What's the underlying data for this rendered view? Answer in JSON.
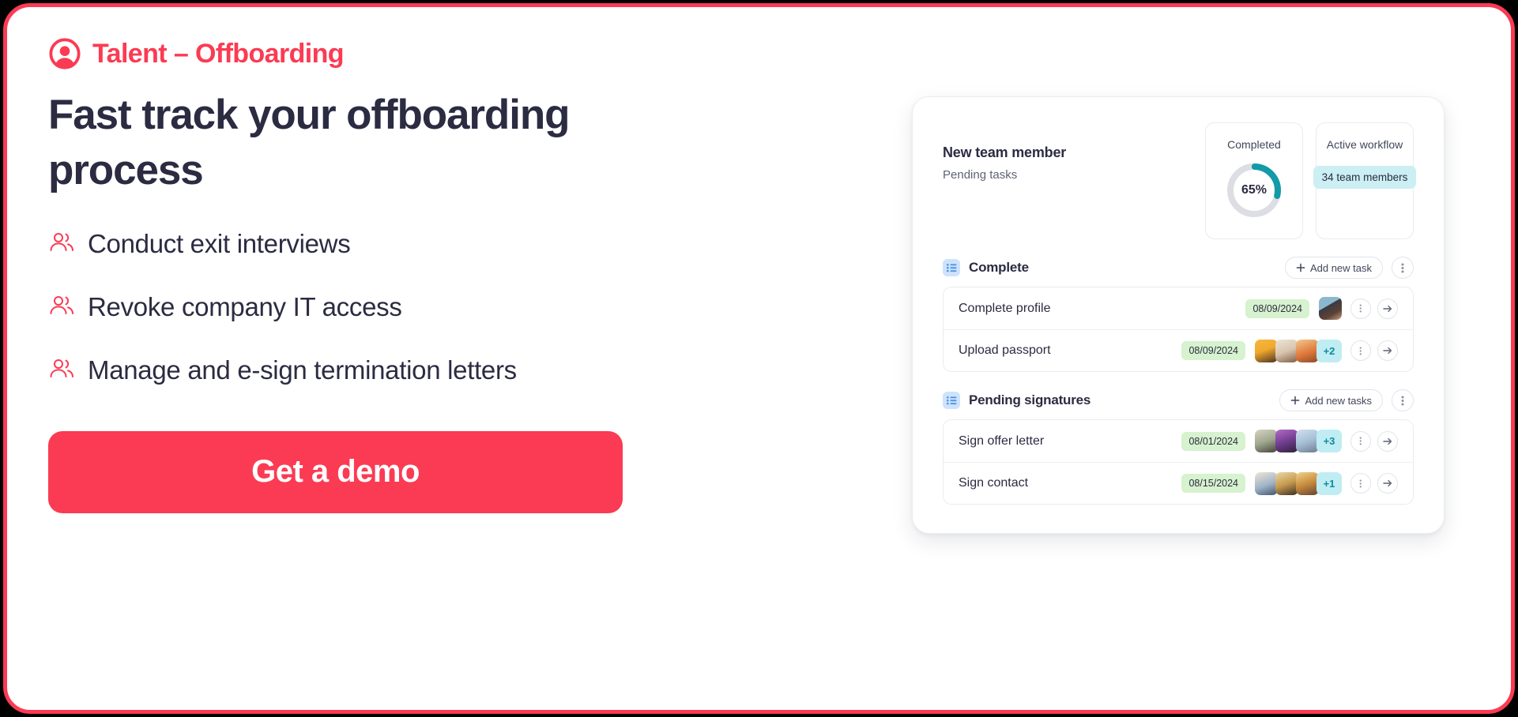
{
  "brand": {
    "accent": "#FB3B53",
    "ink": "#2B2B42",
    "teal": "#129AA8",
    "chip_teal_bg": "#CBEFF2",
    "chip_green_bg": "#D6F2CE",
    "blue_icon_bg": "#CEE3FB"
  },
  "hero": {
    "eyebrow": "Talent – Offboarding",
    "eyebrow_icon": "person-circle-icon",
    "headline": "Fast track your offboarding process",
    "bullets": [
      {
        "icon": "people-icon",
        "label": "Conduct exit interviews"
      },
      {
        "icon": "people-icon",
        "label": "Revoke company IT access"
      },
      {
        "icon": "people-icon",
        "label": "Manage and e-sign termination letters"
      }
    ],
    "cta_label": "Get a demo"
  },
  "app": {
    "title": "New team member",
    "subtitle": "Pending tasks",
    "stats": [
      {
        "label": "Completed",
        "kind": "donut",
        "value": "65%",
        "percent": 65,
        "arc_color": "#129AA8",
        "track_color": "#DCDEE3"
      },
      {
        "label": "Active workflow",
        "kind": "chip",
        "chip": "34 team members"
      }
    ],
    "sections": [
      {
        "icon": "list-icon",
        "title": "Complete",
        "add_label": "Add new task",
        "menu_icon": "more-vertical-icon",
        "rows": [
          {
            "label": "Complete profile",
            "date": "08/09/2024",
            "avatars": [
              "avatar-woman-dark-jacket"
            ],
            "extra": null
          },
          {
            "label": "Upload passport",
            "date": "08/09/2024",
            "avatars": [
              "avatar-woman-yellow",
              "avatar-woman-headscarf",
              "avatar-group-orange"
            ],
            "extra": "+2"
          }
        ]
      },
      {
        "icon": "list-icon",
        "title": "Pending signatures",
        "add_label": "Add new tasks",
        "menu_icon": "more-vertical-icon",
        "rows": [
          {
            "label": "Sign offer letter",
            "date": "08/01/2024",
            "avatars": [
              "avatar-woman-green",
              "avatar-person-purple",
              "avatar-woman-blue"
            ],
            "extra": "+3"
          },
          {
            "label": "Sign contact",
            "date": "08/15/2024",
            "avatars": [
              "avatar-woman-cream",
              "avatar-person-tan",
              "avatar-woman-pattern"
            ],
            "extra": "+1"
          }
        ]
      }
    ],
    "row_menu_icon": "more-vertical-icon",
    "row_action_icon": "arrow-right-circle-icon"
  }
}
